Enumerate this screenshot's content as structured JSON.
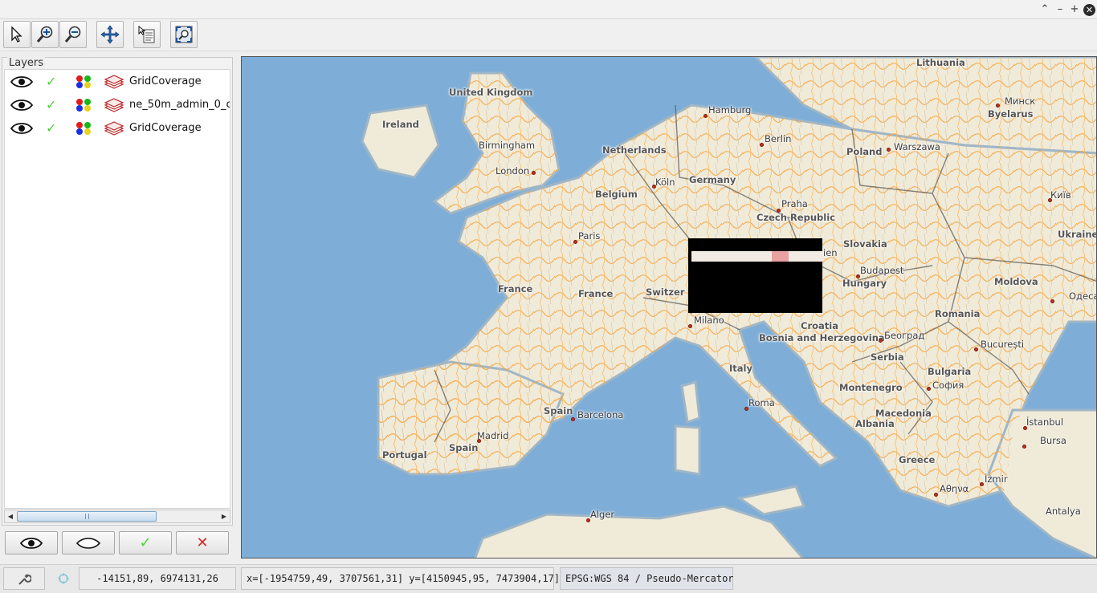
{
  "window": {
    "minimize": "–",
    "restore": "⌃",
    "maximize": "+",
    "close": "✕"
  },
  "toolbar": {
    "tools": [
      {
        "name": "select-tool",
        "icon": "arrow-pointer-icon"
      },
      {
        "name": "zoom-in-tool",
        "icon": "zoom-in-icon"
      },
      {
        "name": "zoom-out-tool",
        "icon": "zoom-out-icon"
      },
      {
        "name": "pan-tool",
        "icon": "pan-icon"
      },
      {
        "name": "info-tool",
        "icon": "info-icon"
      },
      {
        "name": "zoom-extent-tool",
        "icon": "zoom-extent-icon"
      }
    ]
  },
  "layers": {
    "title": "Layers",
    "items": [
      {
        "label": "GridCoverage",
        "visible": true,
        "selected": true
      },
      {
        "label": "ne_50m_admin_0_c",
        "visible": true,
        "selected": true
      },
      {
        "label": "GridCoverage",
        "visible": true,
        "selected": true
      }
    ],
    "buttons": [
      "show-all-icon",
      "hide-all-icon",
      "select-all-icon",
      "remove-icon"
    ]
  },
  "map": {
    "labels": [
      {
        "text": "Lithuania",
        "kind": "country"
      },
      {
        "text": "United Kingdom",
        "kind": "country"
      },
      {
        "text": "Ireland",
        "kind": "country"
      },
      {
        "text": "Hamburg",
        "kind": "city"
      },
      {
        "text": "Минск",
        "kind": "city"
      },
      {
        "text": "Byelarus",
        "kind": "country"
      },
      {
        "text": "Birmingham",
        "kind": "city"
      },
      {
        "text": "Netherlands",
        "kind": "country"
      },
      {
        "text": "Berlin",
        "kind": "city"
      },
      {
        "text": "Poland",
        "kind": "country"
      },
      {
        "text": "Warszawa",
        "kind": "city"
      },
      {
        "text": "London",
        "kind": "city"
      },
      {
        "text": "Germany",
        "kind": "country"
      },
      {
        "text": "Köln",
        "kind": "city"
      },
      {
        "text": "Belgium",
        "kind": "country"
      },
      {
        "text": "Praha",
        "kind": "city"
      },
      {
        "text": "Київ",
        "kind": "city"
      },
      {
        "text": "Czech Republic",
        "kind": "country"
      },
      {
        "text": "Paris",
        "kind": "city"
      },
      {
        "text": "Slovakia",
        "kind": "country"
      },
      {
        "text": "Ukraine",
        "kind": "country"
      },
      {
        "text": "ien",
        "kind": "city"
      },
      {
        "text": "Budapest",
        "kind": "city"
      },
      {
        "text": "France",
        "kind": "country"
      },
      {
        "text": "Hungary",
        "kind": "country"
      },
      {
        "text": "Moldova",
        "kind": "country"
      },
      {
        "text": "France",
        "kind": "country"
      },
      {
        "text": "Switzer",
        "kind": "country"
      },
      {
        "text": "Одеса",
        "kind": "city"
      },
      {
        "text": "Romania",
        "kind": "country"
      },
      {
        "text": "Milano",
        "kind": "city"
      },
      {
        "text": "Croatia",
        "kind": "country"
      },
      {
        "text": "Bosnia and Herzegovina",
        "kind": "country"
      },
      {
        "text": "Београд",
        "kind": "city"
      },
      {
        "text": "București",
        "kind": "city"
      },
      {
        "text": "Serbia",
        "kind": "country"
      },
      {
        "text": "Italy",
        "kind": "country"
      },
      {
        "text": "Bulgaria",
        "kind": "country"
      },
      {
        "text": "София",
        "kind": "city"
      },
      {
        "text": "Montenegro",
        "kind": "country"
      },
      {
        "text": "Spain",
        "kind": "country"
      },
      {
        "text": "Barcelona",
        "kind": "city"
      },
      {
        "text": "Roma",
        "kind": "city"
      },
      {
        "text": "Macedonia",
        "kind": "country"
      },
      {
        "text": "Albania",
        "kind": "country"
      },
      {
        "text": "İstanbul",
        "kind": "city"
      },
      {
        "text": "Madrid",
        "kind": "city"
      },
      {
        "text": "Bursa",
        "kind": "city"
      },
      {
        "text": "Spain",
        "kind": "country"
      },
      {
        "text": "Portugal",
        "kind": "country"
      },
      {
        "text": "Greece",
        "kind": "country"
      },
      {
        "text": "İzmir",
        "kind": "city"
      },
      {
        "text": "Αθηνα",
        "kind": "city"
      },
      {
        "text": "Alger",
        "kind": "city"
      },
      {
        "text": "Antalya",
        "kind": "city"
      }
    ]
  },
  "status": {
    "coords": "-14151,89, 6974131,26",
    "extent": "x=[-1954759,49, 3707561,31] y=[4150945,95, 7473904,17]",
    "crs": "EPSG:WGS 84 / Pseudo-Mercator"
  }
}
